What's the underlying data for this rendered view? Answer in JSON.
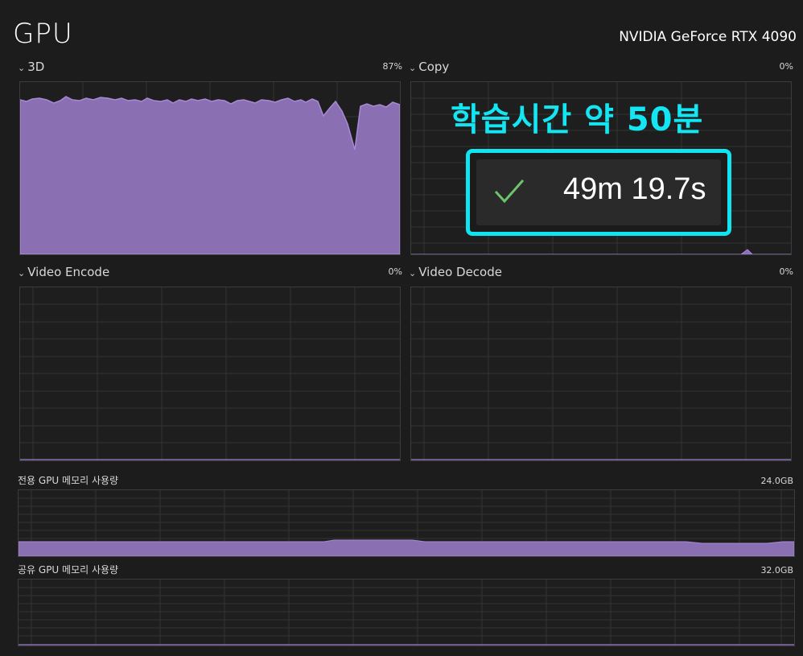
{
  "header": {
    "title": "GPU",
    "device": "NVIDIA GeForce RTX 4090"
  },
  "panels": {
    "threed": {
      "label": "3D",
      "value": "87%",
      "utilization": 87
    },
    "copy": {
      "label": "Copy",
      "value": "0%",
      "utilization": 0
    },
    "video_encode": {
      "label": "Video Encode",
      "value": "0%",
      "utilization": 0
    },
    "video_decode": {
      "label": "Video Decode",
      "value": "0%",
      "utilization": 0
    }
  },
  "memory": {
    "dedicated": {
      "label": "전용 GPU 메모리 사용량",
      "value": "24.0GB"
    },
    "shared": {
      "label": "공유 GPU 메모리 사용량",
      "value": "32.0GB"
    }
  },
  "overlay": {
    "title": "학습시간 약 50분",
    "timer": "49m 19.7s",
    "accent": "#13e6f2",
    "check_color": "#6cc56c"
  },
  "colors": {
    "graph_fill": "#8a6fb3",
    "graph_line": "#a889d6",
    "grid": "#343434"
  }
}
